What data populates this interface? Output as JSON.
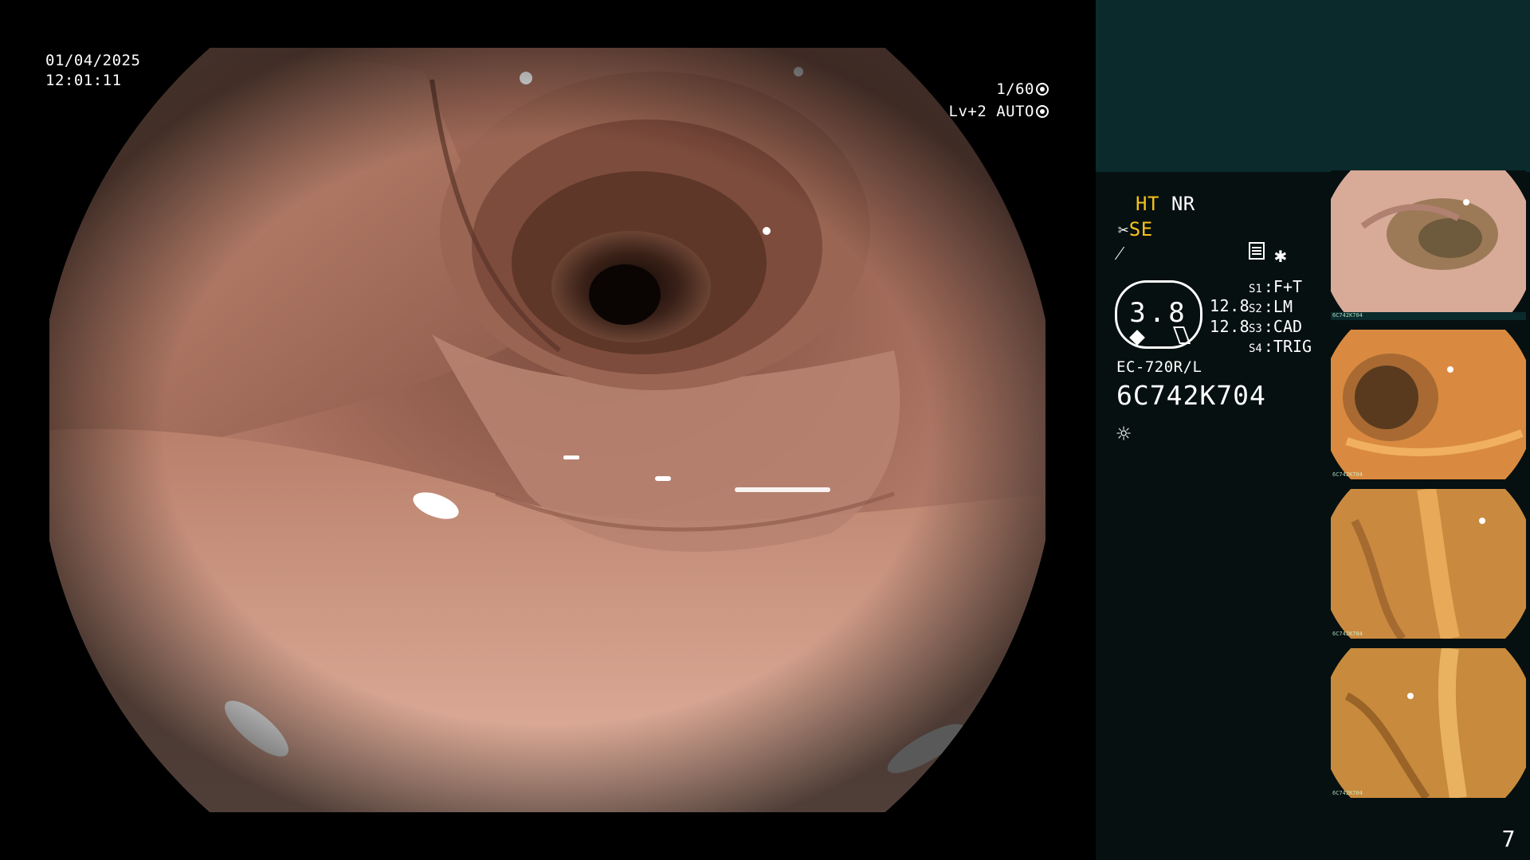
{
  "overlay": {
    "date": "01/04/2025",
    "time": "12:01:11",
    "shutter": "1/60",
    "level_mode": "Lv+2 AUTO"
  },
  "panel": {
    "mode_ht": "HT",
    "mode_nr": "NR",
    "mode_se": "SE",
    "zoom": "3.8",
    "level_top": "12.8",
    "level_bottom": "12.8",
    "switches": [
      {
        "key": "S1",
        "value": "F+T"
      },
      {
        "key": "S2",
        "value": "LM"
      },
      {
        "key": "S3",
        "value": "CAD"
      },
      {
        "key": "S4",
        "value": "TRIG"
      }
    ],
    "scope_model": "EC-720R/L",
    "serial": "6C742K704",
    "page": "7"
  },
  "thumbnails": {
    "label": "6C742K704"
  },
  "icons": [
    "shutter-icon",
    "auto-iris-icon",
    "scissors-icon",
    "cut-icon",
    "menu-list-icon",
    "star-icon",
    "light-icon"
  ],
  "colors": {
    "mode_accent": "#f6c21a",
    "panel_bg": "#061010",
    "header_bg": "#0b2a2c",
    "mucosa": "#c48a78"
  }
}
